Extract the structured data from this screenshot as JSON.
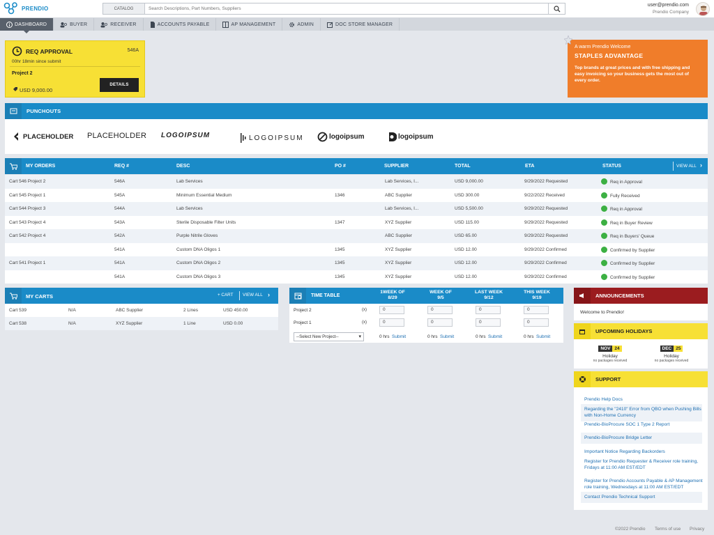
{
  "header": {
    "brand": "PRENDIO",
    "catalog_label": "CATALOG",
    "search_placeholder": "Search Descriptions, Part Numbers, Suppliers",
    "user_email": "user@prendio.com",
    "company": "Prendio Company"
  },
  "nav": [
    {
      "label": "DASHBOARD",
      "icon": "info-icon",
      "active": true
    },
    {
      "label": "BUYER",
      "icon": "users-icon"
    },
    {
      "label": "RECEIVER",
      "icon": "users-icon"
    },
    {
      "label": "ACCOUNTS PAYABLE",
      "icon": "document-icon"
    },
    {
      "label": "AP MANAGEMENT",
      "icon": "columns-icon"
    },
    {
      "label": "ADMIN",
      "icon": "gear-icon"
    },
    {
      "label": "DOC STORE MANAGER",
      "icon": "edit-icon"
    }
  ],
  "req_card": {
    "title": "REQ APPROVAL",
    "req_num": "546A",
    "since": "00hr 18min since submit",
    "project": "Project 2",
    "amount": "USD 9,000.00",
    "details_label": "DETAILS"
  },
  "promo": {
    "line1": "A warm Prendio Welcome",
    "title": "STAPLES ADVANTAGE",
    "body": "Top brands at great prices and with free shipping and easy invoicing so your business gets the most out of every order."
  },
  "punchouts": {
    "title": "PUNCHOUTS",
    "logos": [
      "PLACEHOLDER",
      "PLACEHOLDER",
      "LOGOIPSUM",
      "LOGOIPSUM",
      "logoipsum",
      "logoipsum"
    ]
  },
  "orders": {
    "title": "MY ORDERS",
    "view_all": "VIEW ALL",
    "columns": [
      "REQ #",
      "DESC",
      "PO #",
      "SUPPLIER",
      "TOTAL",
      "ETA",
      "STATUS"
    ],
    "rows": [
      {
        "cart": "Cart 546 Project 2",
        "req": "546A",
        "desc": "Lab Services",
        "po": "",
        "supplier": "Lab Services, I...",
        "total": "USD 9,000.00",
        "eta": "9/29/2022 Requested",
        "status": "Req in Approval"
      },
      {
        "cart": "Cart 545 Project 1",
        "req": "545A",
        "desc": "Minimum Essential Medium",
        "po": "1346",
        "supplier": "ABC Supplier",
        "total": "USD 300.00",
        "eta": "9/22/2022 Received",
        "status": "Fully Received"
      },
      {
        "cart": "Cart 544 Project 3",
        "req": "544A",
        "desc": "Lab Services",
        "po": "",
        "supplier": "Lab Services, I...",
        "total": "USD 5,500.00",
        "eta": "9/29/2022 Requested",
        "status": "Req in Approval"
      },
      {
        "cart": "Cart 543 Project 4",
        "req": "543A",
        "desc": "Sterile Disposable Filter Units",
        "po": "1347",
        "supplier": "XYZ Supplier",
        "total": "USD 115.00",
        "eta": "9/29/2022 Requested",
        "status": "Req in Buyer Review"
      },
      {
        "cart": "Cart 542 Project 4",
        "req": "542A",
        "desc": "Purple Nitrile Gloves",
        "po": "",
        "supplier": "ABC Supplier",
        "total": "USD 65.00",
        "eta": "9/29/2022 Requested",
        "status": "Req in Buyers' Queue"
      },
      {
        "cart": "",
        "req": "541A",
        "desc": "Custom DNA Oligos 1",
        "po": "1345",
        "supplier": "XYZ Supplier",
        "total": "USD 12.00",
        "eta": "9/29/2022 Confirmed",
        "status": "Confirmed by Supplier"
      },
      {
        "cart": "Cart 541 Project 1",
        "req": "541A",
        "desc": "Custom DNA Oligos 2",
        "po": "1345",
        "supplier": "XYZ Supplier",
        "total": "USD 12.00",
        "eta": "9/29/2022 Confirmed",
        "status": "Confirmed by Supplier"
      },
      {
        "cart": "",
        "req": "541A",
        "desc": "Custom DNA Oligos 3",
        "po": "1345",
        "supplier": "XYZ Supplier",
        "total": "USD 12.00",
        "eta": "9/29/2022 Confirmed",
        "status": "Confirmed by Supplier"
      }
    ]
  },
  "carts": {
    "title": "MY CARTS",
    "add_label": "+ CART",
    "view_all": "VIEW ALL",
    "rows": [
      {
        "cart": "Cart 539",
        "na": "N/A",
        "supplier": "ABC Supplier",
        "lines": "2 Lines",
        "total": "USD 450.00"
      },
      {
        "cart": "Cart 538",
        "na": "N/A",
        "supplier": "XYZ Supplier",
        "lines": "1 Line",
        "total": "USD 0.00"
      }
    ]
  },
  "timetable": {
    "title": "TIME TABLE",
    "weeks": [
      {
        "l1": "1WEEK OF",
        "l2": "8/29"
      },
      {
        "l1": "WEEK OF",
        "l2": "9/5"
      },
      {
        "l1": "LAST WEEK",
        "l2": "9/12"
      },
      {
        "l1": "THIS WEEK",
        "l2": "9/19"
      }
    ],
    "rows": [
      {
        "project": "Project 2",
        "x": "(x)",
        "values": [
          "0",
          "0",
          "0",
          "0"
        ]
      },
      {
        "project": "Project 1",
        "x": "(x)",
        "values": [
          "0",
          "0",
          "0",
          "0"
        ]
      }
    ],
    "select_label": "--Select New Project--",
    "hrs": [
      "0 hrs",
      "0 hrs",
      "0 hrs",
      "0 hrs"
    ],
    "submit": "Submit"
  },
  "announcements": {
    "title": "ANNOUNCEMENTS",
    "text": "Welcome to Prendio!"
  },
  "holidays": {
    "title": "UPCOMING HOLIDAYS",
    "items": [
      {
        "month": "NOV",
        "day": "24",
        "label": "Holiday",
        "note": "no packages received"
      },
      {
        "month": "DEC",
        "day": "25",
        "label": "Holiday",
        "note": "no packages received"
      }
    ]
  },
  "support": {
    "title": "SUPPORT",
    "links": [
      "Prendio Help Docs",
      "Regarding the \"2410\" Error from QBO when Pushing Bills with Non-Home Currency",
      "Prendio-BioProcure SOC 1 Type 2 Report",
      "Prendio-BioProcure Bridge Letter",
      "Important Notice Regarding Backorders",
      "Register for Prendio Requester & Receiver role training, Fridays at 11:00 AM EST/EDT",
      "Register for Prendio Accounts Payable & AP Management role training, Wednesdays at 11:00 AM EST/EDT",
      "Contact Prendio Technical Support"
    ]
  },
  "footer": {
    "copyright": "©2022 Prendio",
    "terms": "Terms of use",
    "privacy": "Privacy"
  },
  "colors": {
    "blue": "#1a8bc8",
    "yellow": "#f7e035",
    "orange": "#f07d2a",
    "red": "#9b1c1f",
    "green": "#3cb043"
  }
}
